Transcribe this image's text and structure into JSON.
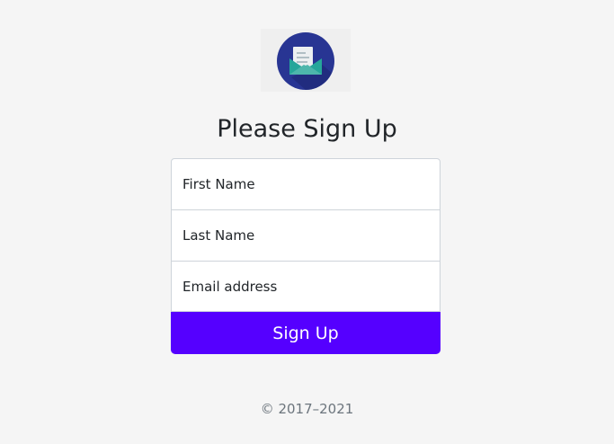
{
  "logo": {
    "icon": "envelope-open-icon",
    "colors": {
      "circle": "#283593",
      "envelope": "#26a69a",
      "letter": "#eceff1"
    }
  },
  "header": {
    "title": "Please Sign Up"
  },
  "form": {
    "first_name": {
      "placeholder": "First Name",
      "value": ""
    },
    "last_name": {
      "placeholder": "Last Name",
      "value": ""
    },
    "email": {
      "placeholder": "Email address",
      "value": ""
    },
    "submit_label": "Sign Up"
  },
  "footer": {
    "copyright": "© 2017–2021"
  },
  "colors": {
    "background": "#f5f5f5",
    "accent": "#5500ff",
    "footer_text": "#6c757d"
  }
}
